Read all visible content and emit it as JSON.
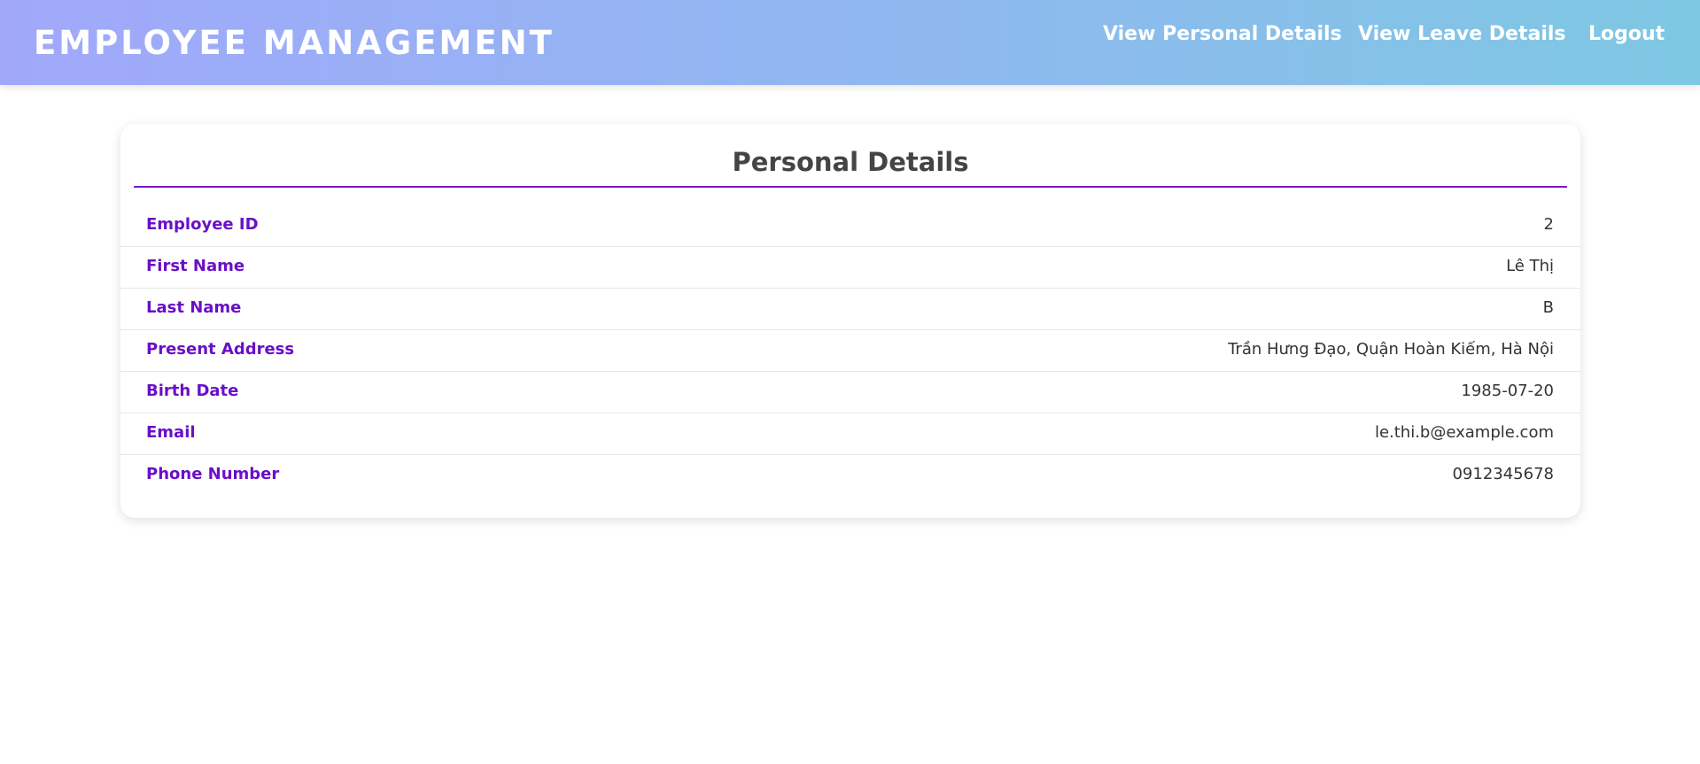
{
  "header": {
    "brand": "EMPLOYEE MANAGEMENT",
    "nav": {
      "personal": "View Personal Details",
      "leave": "View Leave Details",
      "logout": "Logout"
    }
  },
  "details": {
    "title": "Personal Details",
    "rows": [
      {
        "label": "Employee ID",
        "value": "2"
      },
      {
        "label": "First Name",
        "value": "Lê Thị"
      },
      {
        "label": "Last Name",
        "value": "B"
      },
      {
        "label": "Present Address",
        "value": "Trần Hưng Đạo, Quận Hoàn Kiếm, Hà Nội"
      },
      {
        "label": "Birth Date",
        "value": "1985-07-20"
      },
      {
        "label": "Email",
        "value": "le.thi.b@example.com"
      },
      {
        "label": "Phone Number",
        "value": "0912345678"
      }
    ]
  },
  "colors": {
    "header_gradient_start": "#a1a8fb",
    "header_gradient_end": "#7ec8e3",
    "accent_purple": "#6a0fc8",
    "title_text": "#444444"
  }
}
